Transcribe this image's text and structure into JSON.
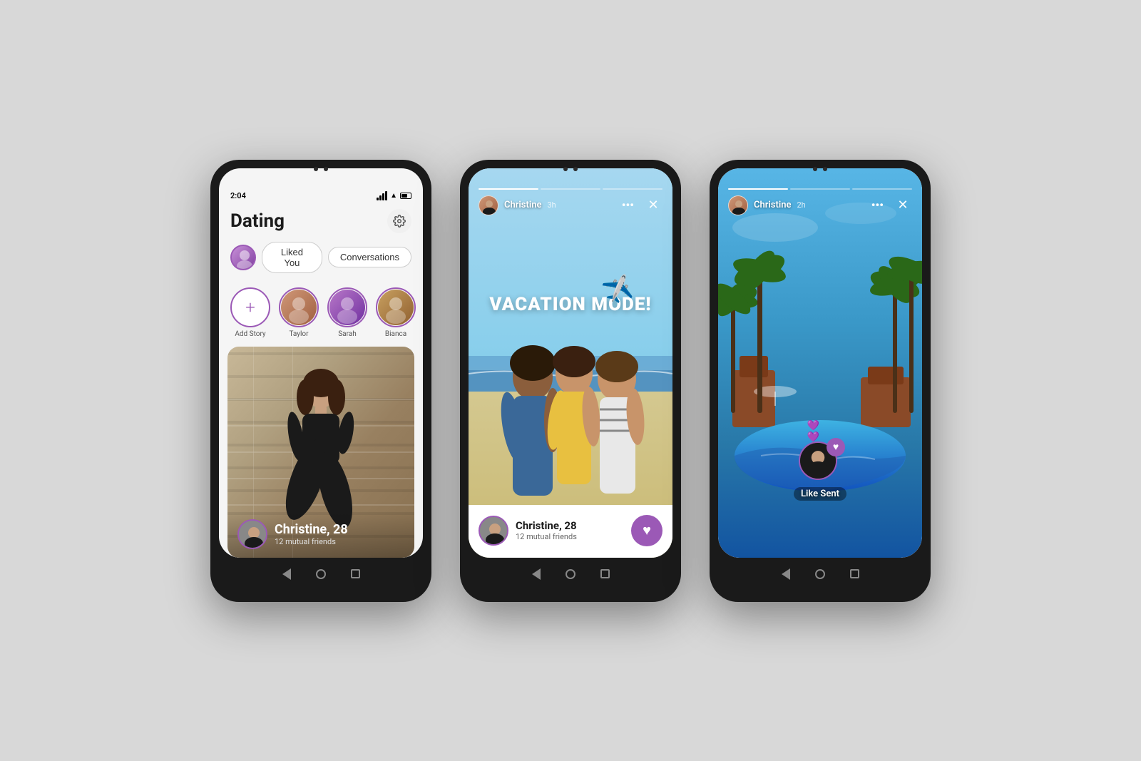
{
  "page": {
    "bg_color": "#d8d8d8"
  },
  "phone1": {
    "status_time": "2:04",
    "title": "Dating",
    "liked_you_label": "Liked You",
    "conversations_label": "Conversations",
    "add_story_label": "Add Story",
    "stories": [
      {
        "name": "Taylor",
        "color": "#c06030"
      },
      {
        "name": "Sarah",
        "color": "#805090"
      },
      {
        "name": "Bianca",
        "color": "#a07040"
      }
    ],
    "profile_name": "Christine, 28",
    "profile_mutual": "12 mutual friends"
  },
  "phone2": {
    "story_user": "Christine",
    "story_time": "3h",
    "vacation_text": "VACATION MODE!",
    "plane_emoji": "✈️",
    "profile_name": "Christine, 28",
    "profile_mutual": "12 mutual friends",
    "close_label": "✕",
    "dots_label": "•••"
  },
  "phone3": {
    "story_user": "Christine",
    "story_time": "2h",
    "like_sent_label": "Like Sent",
    "close_label": "✕",
    "dots_label": "•••",
    "heart_emoji": "💜"
  }
}
